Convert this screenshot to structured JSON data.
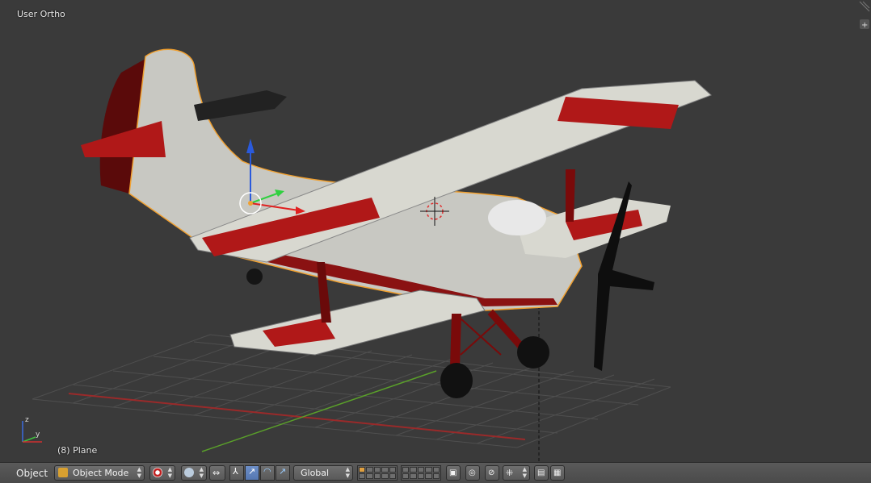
{
  "viewport": {
    "view_name": "User Ortho",
    "object_info": "(8) Plane",
    "axis_labels": {
      "z": "z",
      "y": "y"
    }
  },
  "header": {
    "menu_label": "Object",
    "mode_label": "Object Mode",
    "orientation_label": "Global",
    "icons": [
      "editor-type-icon",
      "viewport-shading-icon",
      "pivot-point-icon",
      "snap-icon",
      "manipulator-icon",
      "translate-icon",
      "rotate-icon",
      "scale-icon",
      "layers-icon",
      "lock-camera-icon",
      "render-preview-icon",
      "proportional-edit-icon",
      "snap-element-icon",
      "render-icon",
      "render-animation-icon"
    ]
  },
  "colors": {
    "viewport_bg": "#3a3a3a",
    "grid": "#505050",
    "x_axis": "#9a2a2a",
    "y_axis": "#5aa02a",
    "selection": "#f0a030",
    "plane_red": "#b01818",
    "plane_white": "#d8d8d0"
  }
}
